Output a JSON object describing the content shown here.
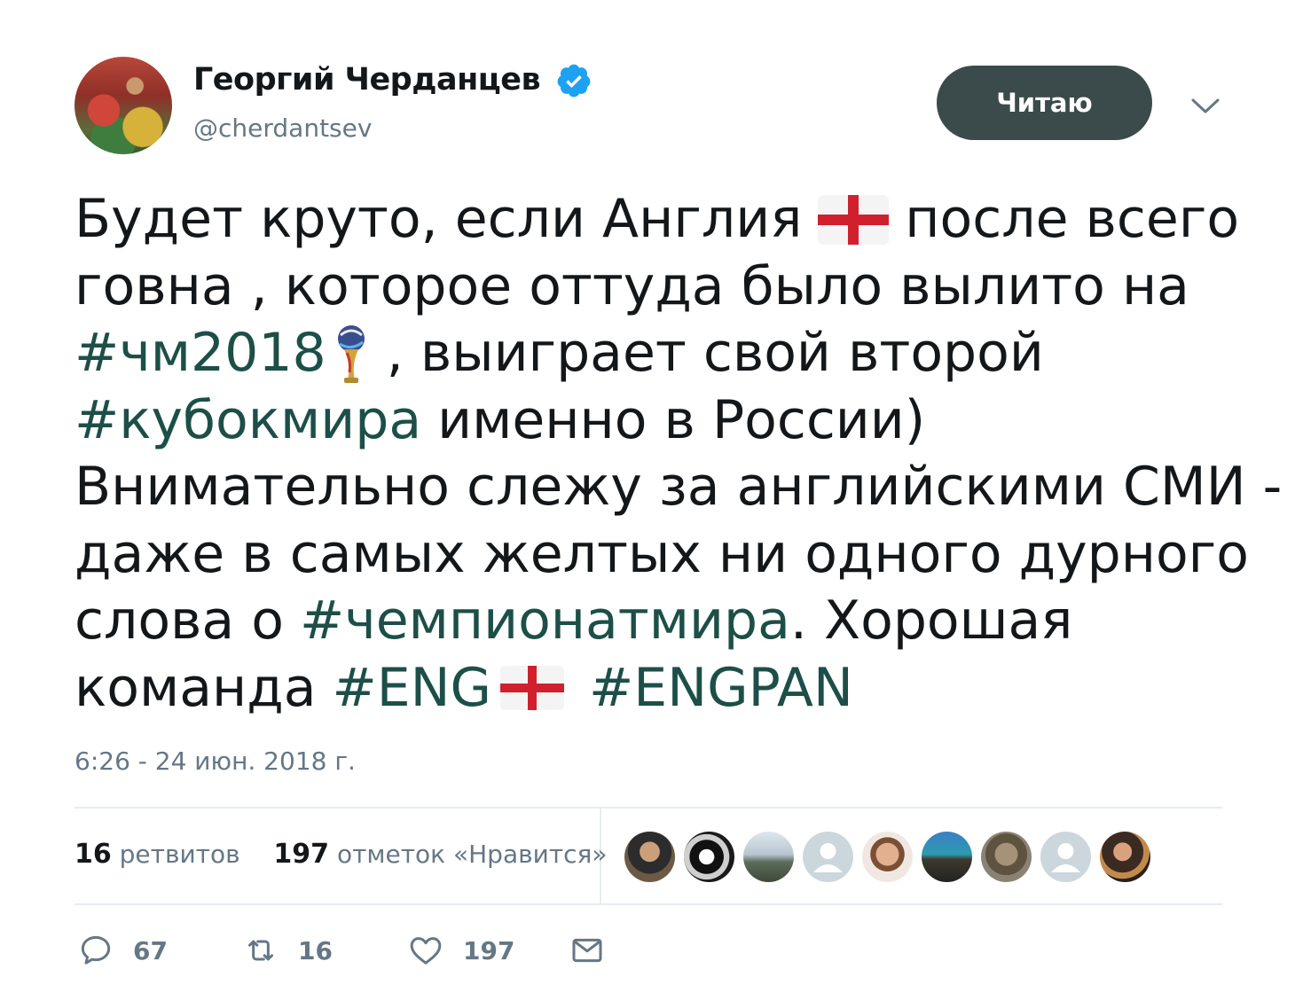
{
  "author": {
    "name": "Георгий Черданцев",
    "handle": "@cherdantsev",
    "verified_icon": "verified-badge-icon",
    "verified_color": "#1da1f2"
  },
  "follow_button": {
    "label": "Читаю",
    "color": "#3b4a4a"
  },
  "menu_icon": "chevron-down-icon",
  "tweet": {
    "line1_a": "Будет круто, если Англия",
    "line1_b": "после всего",
    "line2": "говна , которое оттуда было вылито на",
    "line3_tag": "#чм2018",
    "line3_rest": ", выиграет свой второй",
    "line4_tag": "#кубокмира",
    "line4_rest": "именно в России)",
    "line5": "Внимательно слежу за английскими СМИ -",
    "line6": "даже в самых желтых ни одного дурного",
    "line7_a": "слова о",
    "line7_tag": "#чемпионатмира",
    "line7_b": ". Хорошая",
    "line8_a": "команда",
    "line8_tag1": "#ENG",
    "line8_tag2": "#ENGPAN",
    "hashtag_color": "#1c4f47"
  },
  "timestamp": "6:26 - 24 июн. 2018 г.",
  "stats": {
    "retweets_count": "16",
    "retweets_label": "ретвитов",
    "likes_count": "197",
    "likes_label": "отметок «Нравится»"
  },
  "actions": {
    "reply_count": "67",
    "retweet_count": "16",
    "like_count": "197"
  }
}
